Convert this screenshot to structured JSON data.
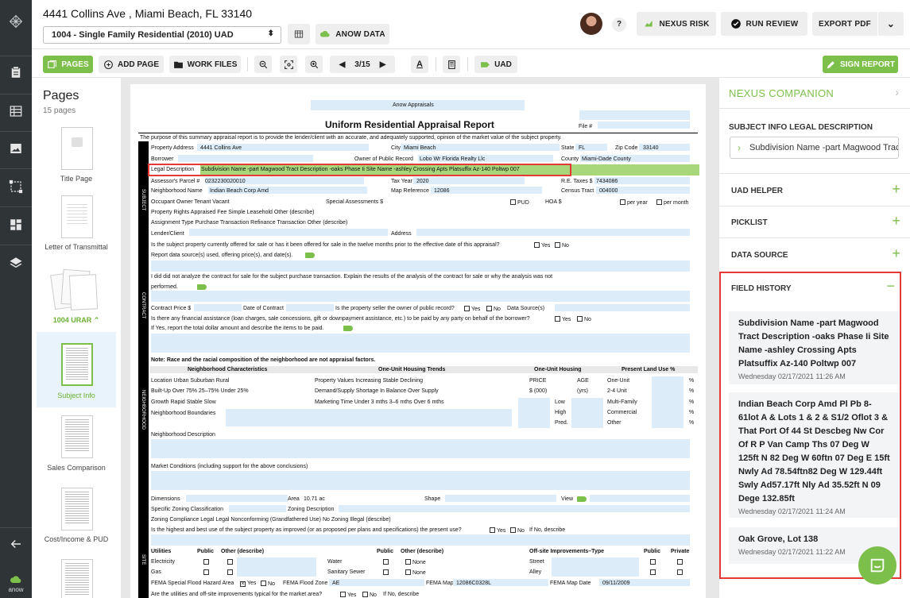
{
  "header": {
    "address": "4441 Collins Ave , Miami Beach, FL 33140",
    "form_select": "1004 - Single Family Residential (2010) UAD",
    "anow_data": "ANOW DATA",
    "help": "?",
    "nexus_risk": "NEXUS RISK",
    "run_review": "RUN REVIEW",
    "export_pdf": "EXPORT PDF"
  },
  "toolbar": {
    "pages": "PAGES",
    "add_page": "ADD PAGE",
    "work_files": "WORK FILES",
    "page_indicator": "3/15",
    "uad": "UAD",
    "sign_report": "SIGN REPORT"
  },
  "rail": {
    "brand": "anow"
  },
  "pages_panel": {
    "title": "Pages",
    "count": "15 pages",
    "items": [
      {
        "label": "Title Page"
      },
      {
        "label": "Letter of Transmittal"
      },
      {
        "label": "1004 URAR"
      },
      {
        "label": "Subject Info"
      },
      {
        "label": "Sales Comparison"
      },
      {
        "label": "Cost/Income & PUD"
      }
    ]
  },
  "document": {
    "company": "Anow Appraisals",
    "title": "Uniform Residential Appraisal Report",
    "file_label": "File #",
    "purpose": "The purpose of this summary appraisal report is to provide the lender/client with an accurate, and adequately supported, opinion of the market value of the subject property.",
    "property_address_label": "Property Address",
    "property_address": "4441 Collins Ave",
    "city_label": "City",
    "city": "Miami Beach",
    "state_label": "State",
    "state": "FL",
    "zip_label": "Zip Code",
    "zip": "33140",
    "borrower_label": "Borrower",
    "owner_label": "Owner of Public Record",
    "owner": "Lobo Wr Florida Realty Llc",
    "county_label": "County",
    "county": "Miami-Dade County",
    "legal_label": "Legal Description",
    "legal": "Subdivision Name -part Magwood Tract Description -oaks Phase Ii Site Name -ashley Crossing Apts Platsuffix Az-140 Poltwp 007",
    "parcel_label": "Assessor's Parcel #",
    "parcel": "0232230020010",
    "taxyear_label": "Tax Year",
    "taxyear": "2020",
    "retaxes_label": "R.E. Taxes $",
    "retaxes": "7434086",
    "neighborhood_label": "Neighborhood Name",
    "neighborhood": "Indian Beach Corp Amd",
    "mapref_label": "Map Reference",
    "mapref": "12086",
    "census_label": "Census Tract",
    "census": "004000",
    "occupant_line": "Occupant    Owner    Tenant    Vacant",
    "special_assess": "Special Assessments $",
    "pud": "PUD",
    "hoa": "HOA $",
    "per_year": "per year",
    "per_month": "per month",
    "rights_line": "Property Rights Appraised    Fee Simple    Leasehold    Other (describe)",
    "assignment_line": "Assignment Type    Purchase Transaction    Refinance Transaction    Other (describe)",
    "lender_label": "Lender/Client",
    "address_label": "Address",
    "offered_q": "Is the subject property currently offered for sale or has it been offered for sale in the twelve months prior to the effective date of this appraisal?",
    "yes": "Yes",
    "no": "No",
    "report_data": "Report data source(s) used, offering price(s), and date(s).",
    "contract_q": "I     did     did not analyze the contract for sale for the subject purchase transaction. Explain the results of the analysis of the contract for sale or why the analysis was not",
    "performed": "performed.",
    "contract_price": "Contract Price $",
    "contract_date": "Date of Contract",
    "seller_q": "Is the property seller the owner of public record?",
    "data_sources": "Data Source(s)",
    "assistance_q": "Is there any financial assistance (loan charges, sale concessions, gift or downpayment assistance, etc.) to be paid by any party on behalf of the borrower?",
    "if_yes": "If Yes, report the total dollar amount and describe the items to be paid.",
    "race_note": "Note: Race and the racial composition of the neighborhood are not appraisal factors.",
    "nb_char": "Neighborhood Characteristics",
    "one_unit_trends": "One-Unit Housing Trends",
    "one_unit_housing": "One-Unit Housing",
    "present_land": "Present Land Use %",
    "location_row": "Location    Urban    Suburban    Rural",
    "builtup_row": "Built-Up    Over 75%    25–75%    Under 25%",
    "growth_row": "Growth    Rapid    Stable    Slow",
    "pv_row": "Property Values    Increasing    Stable    Declining",
    "ds_row": "Demand/Supply    Shortage    In Balance    Over Supply",
    "mt_row": "Marketing Time    Under 3 mths    3–6 mths    Over 6 mths",
    "price": "PRICE",
    "age": "AGE",
    "price_unit": "$ (000)",
    "age_unit": "(yrs)",
    "low": "Low",
    "high": "High",
    "pred": "Pred.",
    "one_unit": "One-Unit",
    "two_four": "2-4 Unit",
    "multi": "Multi-Family",
    "commercial": "Commercial",
    "other": "Other",
    "pct": "%",
    "nb_boundaries": "Neighborhood Boundaries",
    "nb_description": "Neighborhood Description",
    "market_conditions": "Market Conditions (including support for the above conclusions)",
    "dimensions": "Dimensions",
    "area_label": "Area",
    "area": "10.71 ac",
    "shape": "Shape",
    "view": "View",
    "zoning_class": "Specific Zoning Classification",
    "zoning_desc": "Zoning Description",
    "zoning_comp": "Zoning Compliance    Legal    Legal Nonconforming (Grandfathered Use)    No Zoning    Illegal (describe)",
    "hbu_q": "Is the highest and best use of the subject property as improved (or as proposed per plans and specifications) the present use?",
    "if_no": "If No, describe",
    "utilities": "Utilities",
    "public": "Public",
    "other_describe": "Other (describe)",
    "offsite": "Off-site Improvements–Type",
    "private": "Private",
    "electricity": "Electricity",
    "gas": "Gas",
    "water": "Water",
    "sanitary": "Sanitary Sewer",
    "none": "None",
    "street": "Street",
    "alley": "Alley",
    "fema_area": "FEMA Special Flood Hazard Area",
    "fema_zone_label": "FEMA Flood Zone",
    "fema_zone": "AE",
    "fema_map_label": "FEMA Map #",
    "fema_map": "12086C0328L",
    "fema_date_label": "FEMA Map Date",
    "fema_date": "09/11/2009",
    "utilities_q": "Are the utilities and off-site improvements typical for the market area?",
    "if_no2": "If No, describe",
    "side_subject": "SUBJECT",
    "side_contract": "CONTRACT",
    "side_neighborhood": "NEIGHBORHOOD",
    "side_site": "SITE"
  },
  "sidebar": {
    "title": "NEXUS COMPANION",
    "subject_section": "SUBJECT INFO LEGAL DESCRIPTION",
    "legal_value": "Subdivision Name -part Magwood Tract Description -oaks Phase Ii Site Name -ashley Crossing Apts Platsuffix Az-140 Poltwp 007",
    "uad_helper": "UAD HELPER",
    "picklist": "PICKLIST",
    "data_source": "DATA SOURCE",
    "field_history": "FIELD HISTORY",
    "history": [
      {
        "text": "Subdivision Name -part Magwood Tract Description -oaks Phase Ii Site Name -ashley Crossing Apts Platsuffix Az-140 Poltwp 007",
        "date": "Wednesday 02/17/2021 11:26 AM"
      },
      {
        "text": "Indian Beach Corp Amd Pl Pb 8-61lot A & Lots 1 & 2 & S1/2 Oflot 3 & That Port Of 44 St Descbeg Nw Cor Of R P Van Camp Ths 07 Deg W 125ft N 82 Deg W 60ftn 07 Deg E 15ft Nwly Ad 78.54ftn82 Deg W 129.44ft Swly Ad57.17ft Nly Ad 35.52ft N 09 Dege 132.85ft",
        "date": "Wednesday 02/17/2021 11:24 AM"
      },
      {
        "text": "Oak Grove, Lot 138",
        "date": "Wednesday 02/17/2021 11:22 AM"
      }
    ]
  },
  "colors": {
    "accent": "#7cc04b",
    "highlight": "#e53935",
    "field": "#dcecf8"
  }
}
